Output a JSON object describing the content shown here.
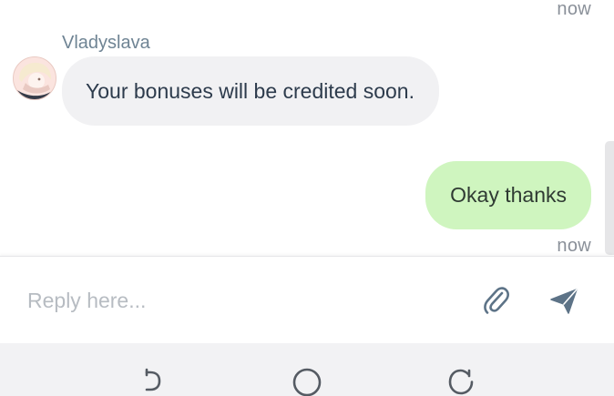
{
  "chat": {
    "top_timestamp": "now",
    "incoming": {
      "sender": "Vladyslava",
      "text": "Your bonuses will be credited soon."
    },
    "outgoing": {
      "text": "Okay thanks",
      "timestamp": "now"
    }
  },
  "composer": {
    "placeholder": "Reply here...",
    "value": ""
  },
  "icons": {
    "avatar": "agent-avatar",
    "attach": "paperclip-icon",
    "send": "send-icon",
    "nav_back": "back-icon",
    "nav_home": "home-icon",
    "nav_recents": "recents-icon"
  },
  "colors": {
    "incoming_bubble": "#f1f1f3",
    "outgoing_bubble": "#cff5bf",
    "icon_accent": "#5d7387"
  }
}
